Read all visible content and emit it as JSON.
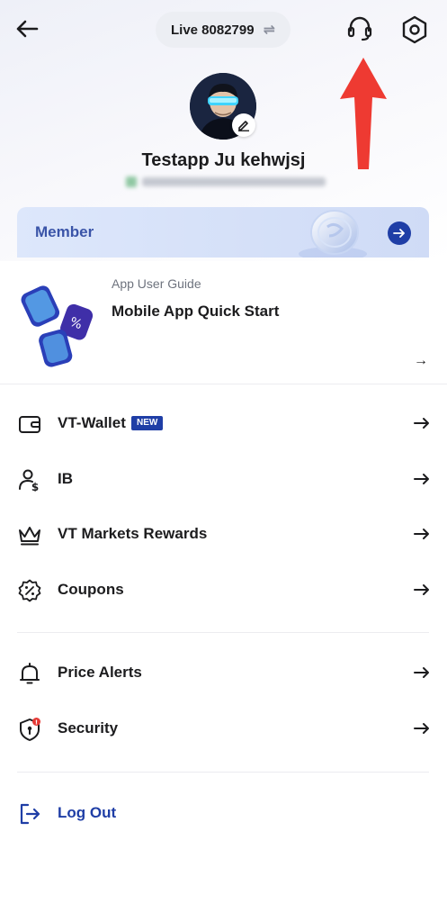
{
  "header": {
    "account_label": "Live 8082799",
    "swap_symbol": "⇌"
  },
  "profile": {
    "name": "Testapp Ju kehwjsj"
  },
  "member": {
    "label": "Member"
  },
  "guide": {
    "kicker": "App User Guide",
    "title": "Mobile App Quick Start",
    "arrow": "→"
  },
  "menu": {
    "group1": [
      {
        "label": "VT-Wallet",
        "badge": "NEW",
        "icon": "wallet-icon"
      },
      {
        "label": "IB",
        "icon": "ib-person-dollar-icon"
      },
      {
        "label": "VT Markets Rewards",
        "icon": "crown-icon"
      },
      {
        "label": "Coupons",
        "icon": "coupon-percent-icon"
      }
    ],
    "group2": [
      {
        "label": "Price Alerts",
        "icon": "bell-icon"
      },
      {
        "label": "Security",
        "icon": "shield-lock-icon",
        "alert_dot": true
      }
    ],
    "logout": {
      "label": "Log Out",
      "icon": "logout-icon"
    }
  },
  "colors": {
    "brand_blue": "#1f3ea6",
    "member_text": "#3a54a8",
    "alert_red": "#e53935",
    "annotation_arrow": "#ee3a32"
  }
}
